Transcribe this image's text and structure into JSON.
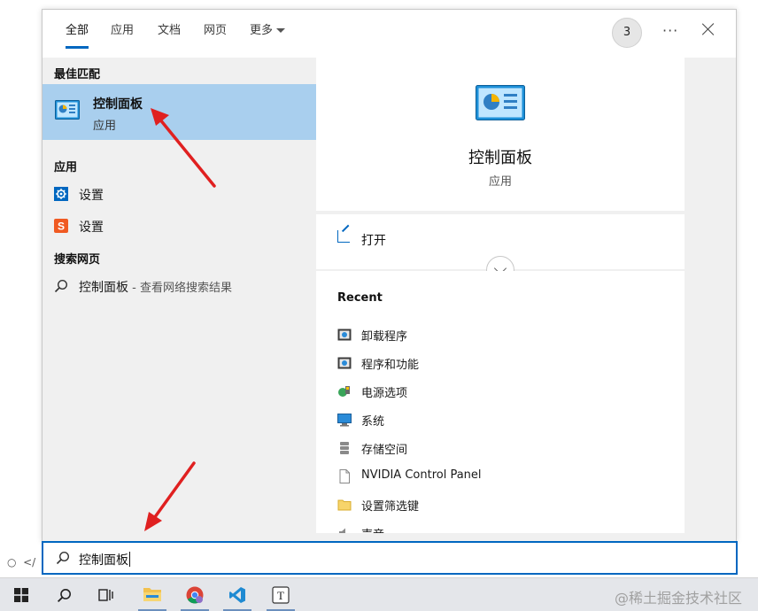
{
  "search_panel": {
    "tabs": [
      {
        "label": "全部",
        "active": true
      },
      {
        "label": "应用"
      },
      {
        "label": "文档"
      },
      {
        "label": "网页"
      },
      {
        "label": "更多"
      }
    ],
    "badge_count": "3",
    "more_options_label": "···"
  },
  "results": {
    "best_match_heading": "最佳匹配",
    "best_match": {
      "title": "控制面板",
      "subtitle": "应用",
      "icon": "control-panel-icon"
    },
    "apps_heading": "应用",
    "apps": [
      {
        "label": "设置",
        "icon": "gear-icon"
      },
      {
        "label": "设置",
        "icon": "s-app-icon"
      }
    ],
    "web_heading": "搜索网页",
    "web_result": {
      "label": "控制面板",
      "suffix": " - 查看网络搜索结果",
      "icon": "search-icon"
    }
  },
  "preview": {
    "title": "控制面板",
    "subtitle": "应用",
    "open_label": "打开",
    "recent_heading": "Recent",
    "recent_items": [
      {
        "label": "卸载程序",
        "icon": "programs-icon"
      },
      {
        "label": "程序和功能",
        "icon": "programs-icon"
      },
      {
        "label": "电源选项",
        "icon": "power-options-icon"
      },
      {
        "label": "系统",
        "icon": "monitor-icon"
      },
      {
        "label": "存储空间",
        "icon": "storage-icon"
      },
      {
        "label": "NVIDIA Control Panel",
        "icon": "document-icon"
      },
      {
        "label": "设置筛选键",
        "icon": "folder-icon"
      },
      {
        "label": "声音",
        "icon": "speaker-icon"
      }
    ]
  },
  "search_box": {
    "value": "控制面板"
  },
  "taskbar": {
    "items": [
      "windows-start-icon",
      "search-icon",
      "task-view-icon",
      "file-explorer-icon",
      "chrome-icon",
      "vscode-icon",
      "typora-icon"
    ],
    "watermark": "@稀土掘金技术社区"
  },
  "colors": {
    "accent": "#0067c0",
    "highlight": "#a9cfee",
    "arrow": "#e02020"
  }
}
